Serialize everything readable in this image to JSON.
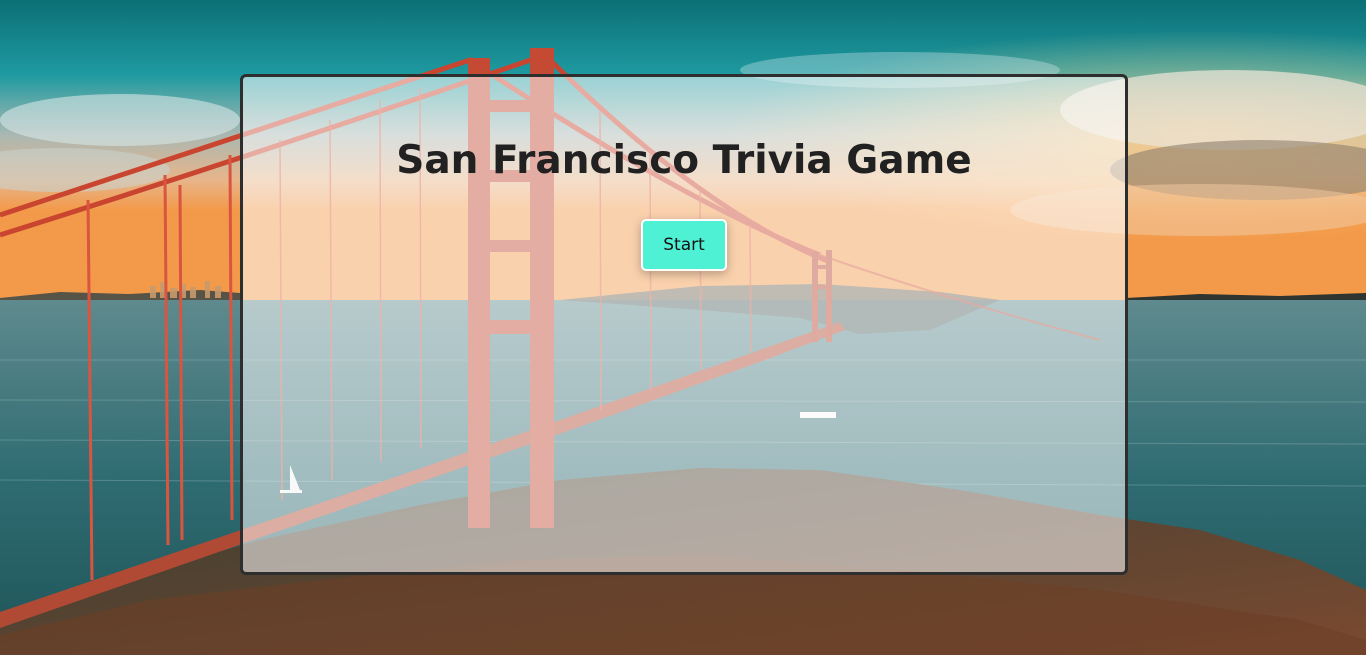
{
  "app": {
    "title": "San Francisco Trivia Game"
  },
  "card": {
    "title": "San Francisco Trivia Game",
    "start_label": "Start"
  },
  "colors": {
    "start_button": "#4ff1d5",
    "card_border": "#2e2e2e",
    "title_text": "#212121",
    "sky_top": "#0f7d82",
    "sunset": "#f39a4a",
    "water": "#2f6c72",
    "bridge": "#d9553f"
  },
  "background": {
    "scene": "golden-gate-bridge-sunset"
  }
}
